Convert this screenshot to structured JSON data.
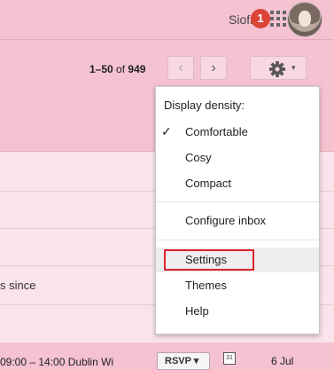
{
  "header": {
    "username": "Siofra",
    "notification_count": "1",
    "icons": [
      "apps-grid-icon",
      "avatar"
    ]
  },
  "toolbar": {
    "pager_range": "1–50",
    "pager_of": "of",
    "pager_total": "949",
    "prev_label": "‹",
    "next_label": "›",
    "gear_icon": "gear-icon",
    "gear_caret": "▾"
  },
  "menu": {
    "header": "Display density:",
    "items": [
      {
        "label": "Comfortable",
        "checked": true
      },
      {
        "label": "Cosy",
        "checked": false
      },
      {
        "label": "Compact",
        "checked": false
      },
      {
        "label": "Configure inbox"
      },
      {
        "label": "Settings",
        "highlighted": true
      },
      {
        "label": "Themes"
      },
      {
        "label": "Help"
      }
    ],
    "check_mark": "✓"
  },
  "mail_list": {
    "row_snippet": "s since",
    "event_text": "09:00 – 14:00 Dublin Wi",
    "rsvp_label": "RSVP ▾",
    "calendar_day": "31",
    "date": "6 Jul"
  },
  "colors": {
    "background": "#f4c2d0",
    "notification": "#db4437",
    "highlight_outline": "#d9232d"
  }
}
